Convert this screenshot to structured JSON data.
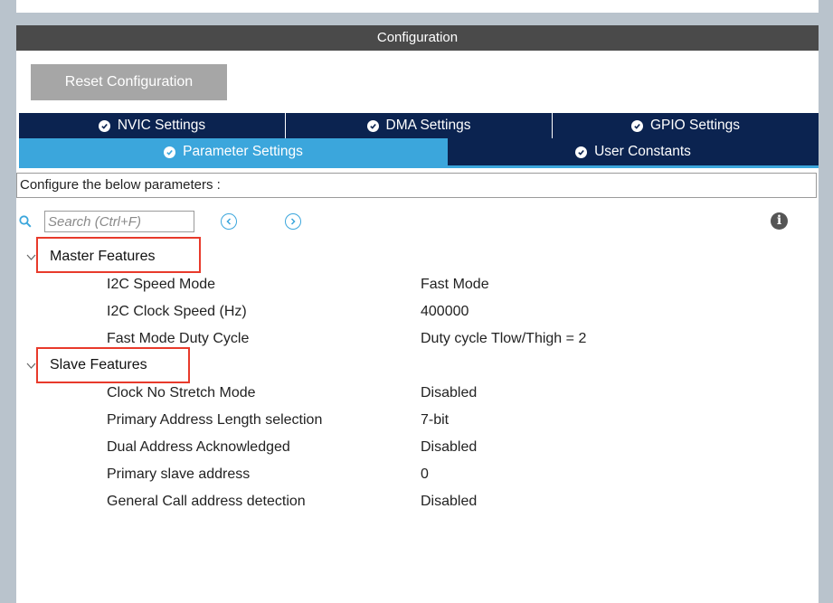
{
  "window": {
    "title": "Configuration"
  },
  "toolbar": {
    "reset_label": "Reset Configuration"
  },
  "tabs": {
    "row1": [
      {
        "label": "NVIC Settings",
        "active": false
      },
      {
        "label": "DMA Settings",
        "active": false
      },
      {
        "label": "GPIO Settings",
        "active": false
      }
    ],
    "row2": [
      {
        "label": "Parameter Settings",
        "active": true
      },
      {
        "label": "User Constants",
        "active": false
      }
    ]
  },
  "description": "Configure the below parameters :",
  "search": {
    "placeholder": "Search (Ctrl+F)",
    "value": ""
  },
  "groups": [
    {
      "label": "Master Features",
      "params": [
        {
          "name": "I2C Speed Mode",
          "value": "Fast Mode"
        },
        {
          "name": "I2C Clock Speed (Hz)",
          "value": "400000"
        },
        {
          "name": "Fast Mode Duty Cycle",
          "value": "Duty cycle Tlow/Thigh = 2"
        }
      ]
    },
    {
      "label": "Slave Features",
      "params": [
        {
          "name": "Clock No Stretch Mode",
          "value": "Disabled"
        },
        {
          "name": "Primary Address Length selection",
          "value": "7-bit"
        },
        {
          "name": "Dual Address Acknowledged",
          "value": "Disabled"
        },
        {
          "name": "Primary slave address",
          "value": "0"
        },
        {
          "name": "General Call address detection",
          "value": "Disabled"
        }
      ]
    }
  ],
  "colors": {
    "title_bar": "#4a4a4a",
    "tab_dark": "#0b2350",
    "tab_active": "#3ba6dc",
    "highlight": "#e83a2b"
  }
}
